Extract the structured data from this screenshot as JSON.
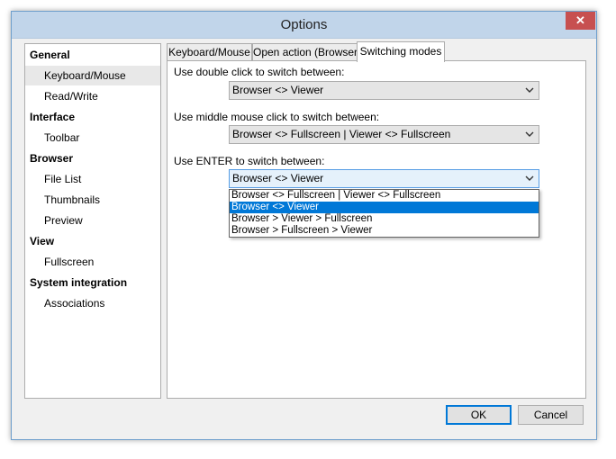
{
  "window": {
    "title": "Options",
    "close_glyph": "✕"
  },
  "nav": {
    "items": [
      {
        "label": "General",
        "kind": "header"
      },
      {
        "label": "Keyboard/Mouse",
        "kind": "child",
        "selected": true
      },
      {
        "label": "Read/Write",
        "kind": "child"
      },
      {
        "label": "Interface",
        "kind": "header"
      },
      {
        "label": "Toolbar",
        "kind": "child"
      },
      {
        "label": "Browser",
        "kind": "header"
      },
      {
        "label": "File List",
        "kind": "child"
      },
      {
        "label": "Thumbnails",
        "kind": "child"
      },
      {
        "label": "Preview",
        "kind": "child"
      },
      {
        "label": "View",
        "kind": "header"
      },
      {
        "label": "Fullscreen",
        "kind": "child"
      },
      {
        "label": "System integration",
        "kind": "header"
      },
      {
        "label": "Associations",
        "kind": "child"
      }
    ]
  },
  "tabs": [
    {
      "label": "Keyboard/Mouse",
      "active": false
    },
    {
      "label": "Open action (Browser)",
      "active": false
    },
    {
      "label": "Switching modes",
      "active": true
    }
  ],
  "panel": {
    "double_click_label": "Use double click to switch between:",
    "double_click_value": "Browser <> Viewer",
    "middle_click_label": "Use middle mouse click to switch between:",
    "middle_click_value": "Browser <> Fullscreen | Viewer <> Fullscreen",
    "enter_label": "Use ENTER to switch between:",
    "enter_value": "Browser <> Viewer",
    "enter_options": [
      {
        "label": "Browser <> Fullscreen | Viewer <> Fullscreen",
        "selected": false
      },
      {
        "label": "Browser <> Viewer",
        "selected": true
      },
      {
        "label": "Browser > Viewer > Fullscreen",
        "selected": false
      },
      {
        "label": "Browser > Fullscreen > Viewer",
        "selected": false
      }
    ]
  },
  "buttons": {
    "ok": "OK",
    "cancel": "Cancel"
  },
  "colors": {
    "accent": "#0078d7",
    "titlebar": "#c1d5ea",
    "close": "#c75050"
  }
}
